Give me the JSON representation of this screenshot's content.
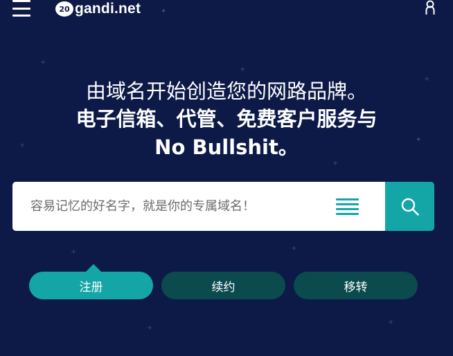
{
  "header": {
    "logo_mark": "20",
    "logo_text": "gandi.net"
  },
  "hero": {
    "line1": "由域名开始创造您的网路品牌。",
    "line2": "电子信箱、代管、免费客户服务与",
    "line3": "No Bullshit。"
  },
  "search": {
    "placeholder": "容易记忆的好名字，就是你的专属域名！"
  },
  "tabs": [
    {
      "label": "注册",
      "active": true
    },
    {
      "label": "续约",
      "active": false
    },
    {
      "label": "移转",
      "active": false
    }
  ],
  "colors": {
    "background": "#0d1a47",
    "accent": "#14a6a6",
    "tab_inactive": "#0b4a4d"
  },
  "icons": [
    "hamburger-menu-icon",
    "user-icon",
    "list-icon",
    "search-icon"
  ]
}
